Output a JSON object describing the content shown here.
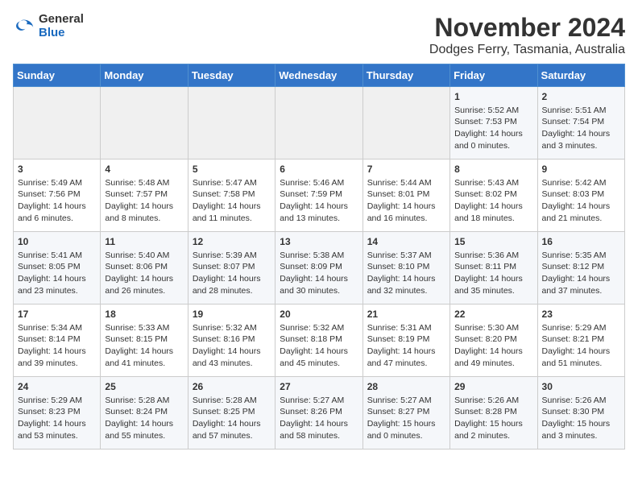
{
  "logo": {
    "general": "General",
    "blue": "Blue"
  },
  "title": "November 2024",
  "subtitle": "Dodges Ferry, Tasmania, Australia",
  "weekdays": [
    "Sunday",
    "Monday",
    "Tuesday",
    "Wednesday",
    "Thursday",
    "Friday",
    "Saturday"
  ],
  "weeks": [
    [
      {
        "day": "",
        "content": ""
      },
      {
        "day": "",
        "content": ""
      },
      {
        "day": "",
        "content": ""
      },
      {
        "day": "",
        "content": ""
      },
      {
        "day": "",
        "content": ""
      },
      {
        "day": "1",
        "content": "Sunrise: 5:52 AM\nSunset: 7:53 PM\nDaylight: 14 hours\nand 0 minutes."
      },
      {
        "day": "2",
        "content": "Sunrise: 5:51 AM\nSunset: 7:54 PM\nDaylight: 14 hours\nand 3 minutes."
      }
    ],
    [
      {
        "day": "3",
        "content": "Sunrise: 5:49 AM\nSunset: 7:56 PM\nDaylight: 14 hours\nand 6 minutes."
      },
      {
        "day": "4",
        "content": "Sunrise: 5:48 AM\nSunset: 7:57 PM\nDaylight: 14 hours\nand 8 minutes."
      },
      {
        "day": "5",
        "content": "Sunrise: 5:47 AM\nSunset: 7:58 PM\nDaylight: 14 hours\nand 11 minutes."
      },
      {
        "day": "6",
        "content": "Sunrise: 5:46 AM\nSunset: 7:59 PM\nDaylight: 14 hours\nand 13 minutes."
      },
      {
        "day": "7",
        "content": "Sunrise: 5:44 AM\nSunset: 8:01 PM\nDaylight: 14 hours\nand 16 minutes."
      },
      {
        "day": "8",
        "content": "Sunrise: 5:43 AM\nSunset: 8:02 PM\nDaylight: 14 hours\nand 18 minutes."
      },
      {
        "day": "9",
        "content": "Sunrise: 5:42 AM\nSunset: 8:03 PM\nDaylight: 14 hours\nand 21 minutes."
      }
    ],
    [
      {
        "day": "10",
        "content": "Sunrise: 5:41 AM\nSunset: 8:05 PM\nDaylight: 14 hours\nand 23 minutes."
      },
      {
        "day": "11",
        "content": "Sunrise: 5:40 AM\nSunset: 8:06 PM\nDaylight: 14 hours\nand 26 minutes."
      },
      {
        "day": "12",
        "content": "Sunrise: 5:39 AM\nSunset: 8:07 PM\nDaylight: 14 hours\nand 28 minutes."
      },
      {
        "day": "13",
        "content": "Sunrise: 5:38 AM\nSunset: 8:09 PM\nDaylight: 14 hours\nand 30 minutes."
      },
      {
        "day": "14",
        "content": "Sunrise: 5:37 AM\nSunset: 8:10 PM\nDaylight: 14 hours\nand 32 minutes."
      },
      {
        "day": "15",
        "content": "Sunrise: 5:36 AM\nSunset: 8:11 PM\nDaylight: 14 hours\nand 35 minutes."
      },
      {
        "day": "16",
        "content": "Sunrise: 5:35 AM\nSunset: 8:12 PM\nDaylight: 14 hours\nand 37 minutes."
      }
    ],
    [
      {
        "day": "17",
        "content": "Sunrise: 5:34 AM\nSunset: 8:14 PM\nDaylight: 14 hours\nand 39 minutes."
      },
      {
        "day": "18",
        "content": "Sunrise: 5:33 AM\nSunset: 8:15 PM\nDaylight: 14 hours\nand 41 minutes."
      },
      {
        "day": "19",
        "content": "Sunrise: 5:32 AM\nSunset: 8:16 PM\nDaylight: 14 hours\nand 43 minutes."
      },
      {
        "day": "20",
        "content": "Sunrise: 5:32 AM\nSunset: 8:18 PM\nDaylight: 14 hours\nand 45 minutes."
      },
      {
        "day": "21",
        "content": "Sunrise: 5:31 AM\nSunset: 8:19 PM\nDaylight: 14 hours\nand 47 minutes."
      },
      {
        "day": "22",
        "content": "Sunrise: 5:30 AM\nSunset: 8:20 PM\nDaylight: 14 hours\nand 49 minutes."
      },
      {
        "day": "23",
        "content": "Sunrise: 5:29 AM\nSunset: 8:21 PM\nDaylight: 14 hours\nand 51 minutes."
      }
    ],
    [
      {
        "day": "24",
        "content": "Sunrise: 5:29 AM\nSunset: 8:23 PM\nDaylight: 14 hours\nand 53 minutes."
      },
      {
        "day": "25",
        "content": "Sunrise: 5:28 AM\nSunset: 8:24 PM\nDaylight: 14 hours\nand 55 minutes."
      },
      {
        "day": "26",
        "content": "Sunrise: 5:28 AM\nSunset: 8:25 PM\nDaylight: 14 hours\nand 57 minutes."
      },
      {
        "day": "27",
        "content": "Sunrise: 5:27 AM\nSunset: 8:26 PM\nDaylight: 14 hours\nand 58 minutes."
      },
      {
        "day": "28",
        "content": "Sunrise: 5:27 AM\nSunset: 8:27 PM\nDaylight: 15 hours\nand 0 minutes."
      },
      {
        "day": "29",
        "content": "Sunrise: 5:26 AM\nSunset: 8:28 PM\nDaylight: 15 hours\nand 2 minutes."
      },
      {
        "day": "30",
        "content": "Sunrise: 5:26 AM\nSunset: 8:30 PM\nDaylight: 15 hours\nand 3 minutes."
      }
    ]
  ]
}
